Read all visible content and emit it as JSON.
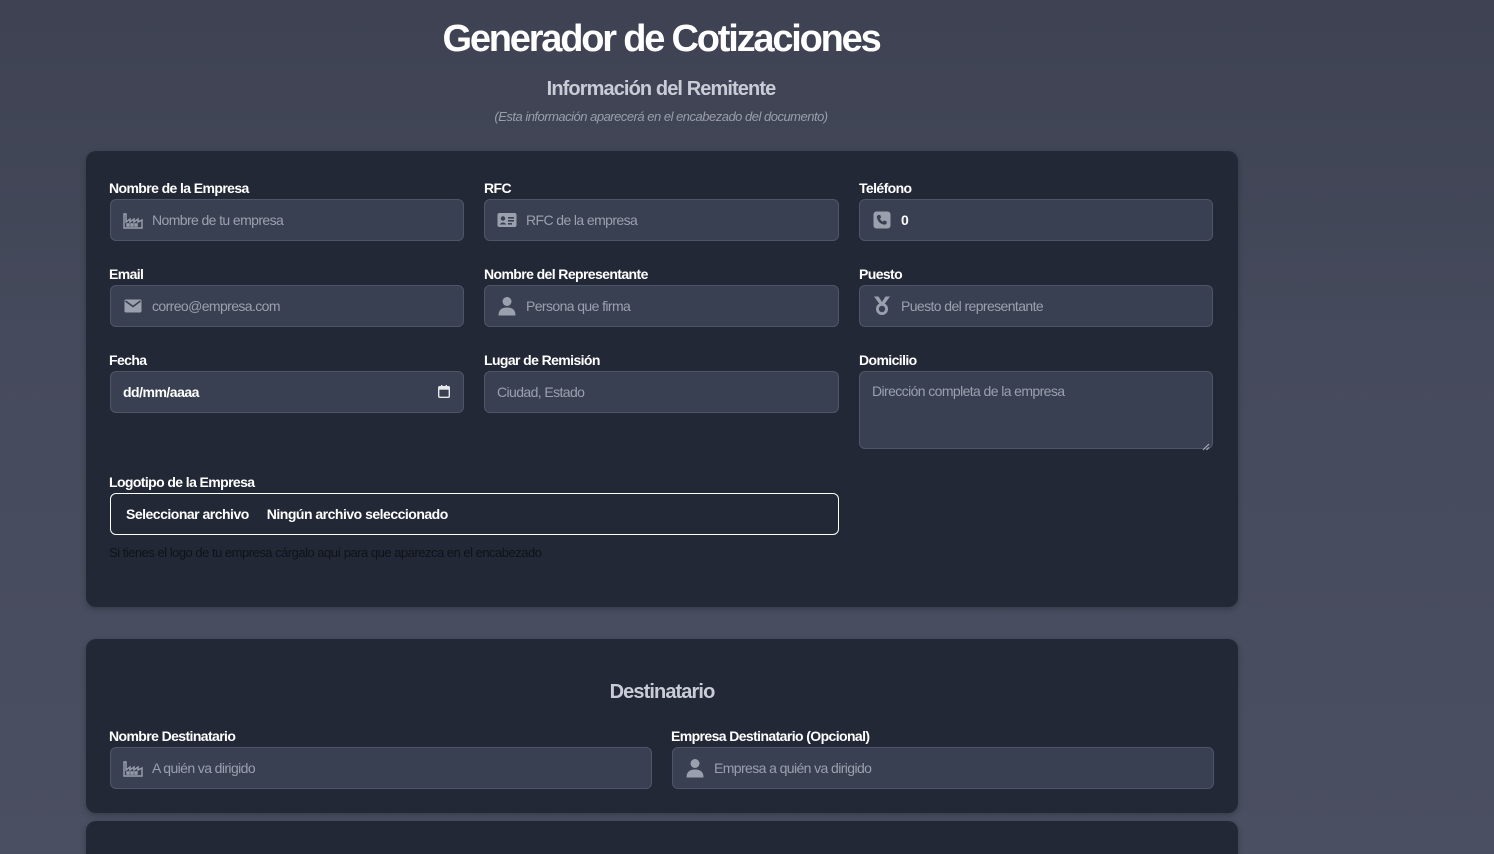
{
  "header": {
    "title": "Generador de Cotizaciones",
    "section_title": "Información del Remitente",
    "section_note": "(Esta información aparecerá en el encabezado del documento)"
  },
  "sender": {
    "company_name": {
      "label": "Nombre de la Empresa",
      "placeholder": "Nombre de tu empresa",
      "icon": "building-icon"
    },
    "rfc": {
      "label": "RFC",
      "placeholder": "RFC de la empresa",
      "icon": "id-card-icon"
    },
    "phone": {
      "label": "Teléfono",
      "value": "0",
      "icon": "phone-icon"
    },
    "email": {
      "label": "Email",
      "placeholder": "correo@empresa.com",
      "icon": "envelope-icon"
    },
    "representative": {
      "label": "Nombre del Representante",
      "placeholder": "Persona que firma",
      "icon": "user-icon"
    },
    "position": {
      "label": "Puesto",
      "placeholder": "Puesto del representante",
      "icon": "medal-icon"
    },
    "date": {
      "label": "Fecha",
      "value": "dd/mm/aaaa",
      "icon": "calendar-icon"
    },
    "place": {
      "label": "Lugar de Remisión",
      "placeholder": "Ciudad, Estado"
    },
    "address": {
      "label": "Domicilio",
      "placeholder": "Dirección completa de la empresa"
    },
    "logo": {
      "label": "Logotipo de la Empresa",
      "button": "Seleccionar archivo",
      "status": "Ningún archivo seleccionado",
      "help": "Si tienes el logo de tu empresa cárgalo aquí para que aparezca en el encabezado"
    }
  },
  "recipient": {
    "title": "Destinatario",
    "name": {
      "label": "Nombre Destinatario",
      "placeholder": "A quién va dirigido",
      "icon": "building-icon"
    },
    "company": {
      "label": "Empresa Destinatario (Opcional)",
      "placeholder": "Empresa a quién va dirigido",
      "icon": "user-icon"
    }
  },
  "colors": {
    "background": "#454a5c",
    "card": "#232836",
    "input": "#394052",
    "placeholder": "#9aa0ad",
    "text": "#ffffff"
  }
}
